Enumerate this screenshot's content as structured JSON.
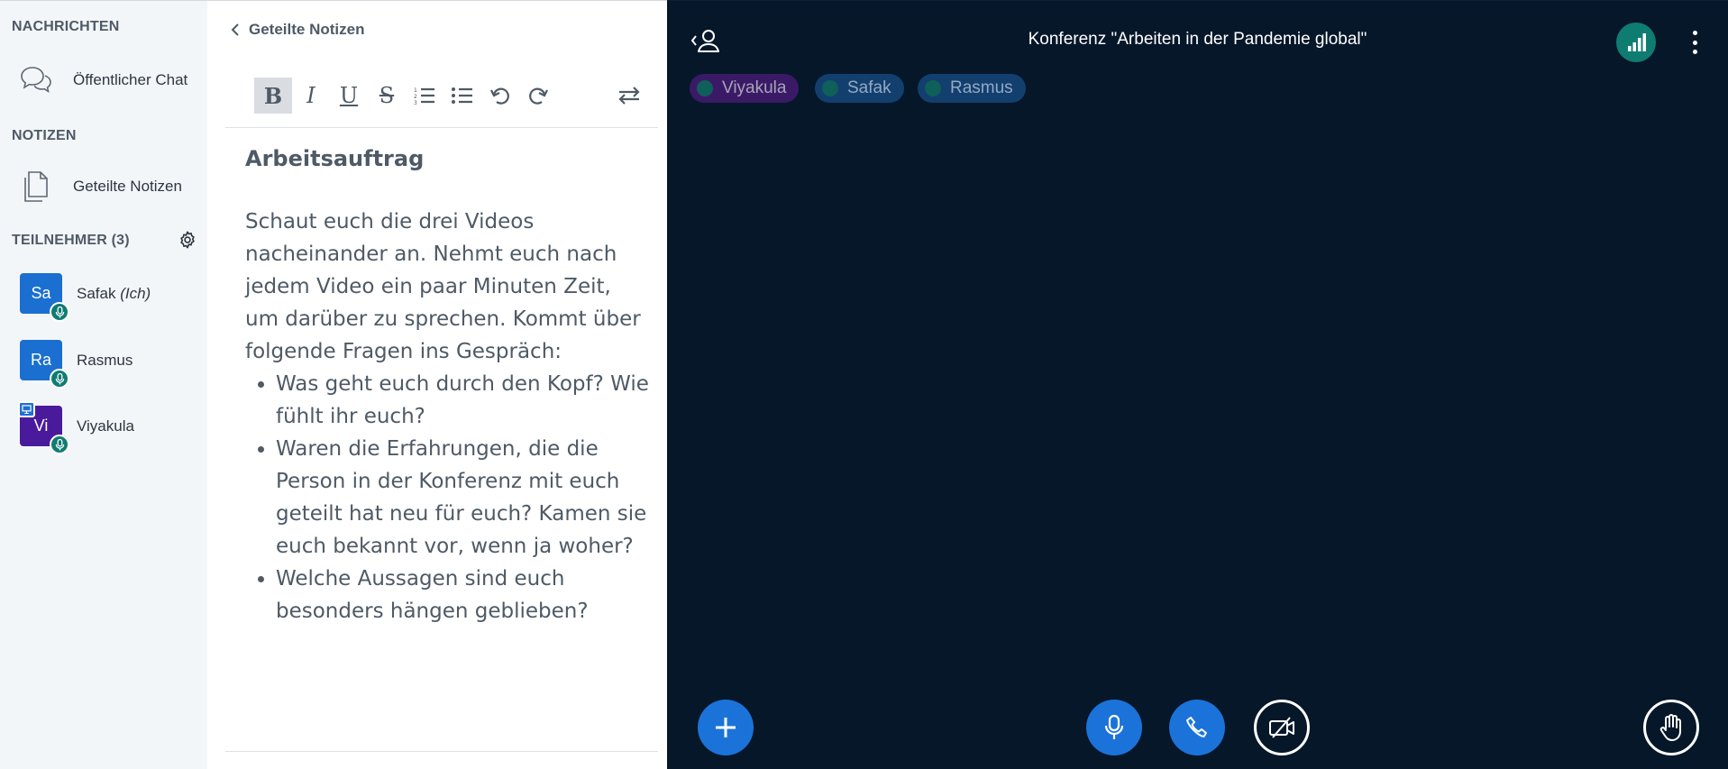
{
  "sidebar": {
    "messages_title": "NACHRICHTEN",
    "public_chat_label": "Öffentlicher Chat",
    "notes_title": "NOTIZEN",
    "shared_notes_label": "Geteilte Notizen",
    "participants_title": "TEILNEHMER (3)",
    "users": [
      {
        "initials": "Sa",
        "name": "Safak",
        "suffix": "(Ich)",
        "color": "#1a6fd0",
        "presenter": false
      },
      {
        "initials": "Ra",
        "name": "Rasmus",
        "suffix": "",
        "color": "#1a6fd0",
        "presenter": false
      },
      {
        "initials": "Vi",
        "name": "Viyakula",
        "suffix": "",
        "color": "#4a1a9c",
        "presenter": true
      }
    ]
  },
  "notes": {
    "back_label": "Geteilte Notizen",
    "toolbar": {
      "bold": "B",
      "italic": "I",
      "underline": "U",
      "strike": "S"
    },
    "heading": "Arbeitsauftrag",
    "paragraph": "Schaut euch die drei Videos nacheinander an. Nehmt euch nach jedem Video ein paar Minuten Zeit, um darüber zu sprechen. Kommt über folgende Fragen ins Gespräch:",
    "bullets": [
      "Was geht euch durch den Kopf? Wie fühlt ihr euch?",
      "Waren die Erfahrungen, die die Person in der Konferenz mit euch geteilt hat neu für euch? Kamen sie euch bekannt vor, wenn ja woher?",
      "Welche Aussagen sind euch besonders hängen geblieben?"
    ]
  },
  "main": {
    "title": "Konferenz \"Arbeiten in der Pandemie global\"",
    "talkers": [
      {
        "name": "Viyakula",
        "bg": "#3a1a66",
        "text": "#a8a3b8",
        "dot": "#0f5f5a"
      },
      {
        "name": "Safak",
        "bg": "#123f6e",
        "text": "#93aac4",
        "dot": "#0f5f5a"
      },
      {
        "name": "Rasmus",
        "bg": "#123f6e",
        "text": "#93aac4",
        "dot": "#0f5f5a"
      }
    ]
  },
  "colors": {
    "accent_blue": "#1b73d9",
    "accent_teal": "#0f7c72",
    "main_bg": "#06172a",
    "sidebar_bg": "#f3f6f9"
  },
  "icons": {
    "chat": "chat-bubbles-icon",
    "notes": "documents-icon",
    "settings": "gear-icon",
    "mic": "microphone-icon",
    "presenter": "presentation-icon",
    "back": "chevron-left-icon",
    "userlist_toggle": "user-toggle-icon",
    "connection": "signal-bars-icon",
    "more": "more-vertical-icon",
    "actions": "plus-icon",
    "audio": "microphone-icon",
    "phone": "phone-icon",
    "video": "camera-off-icon",
    "raise_hand": "hand-icon"
  }
}
